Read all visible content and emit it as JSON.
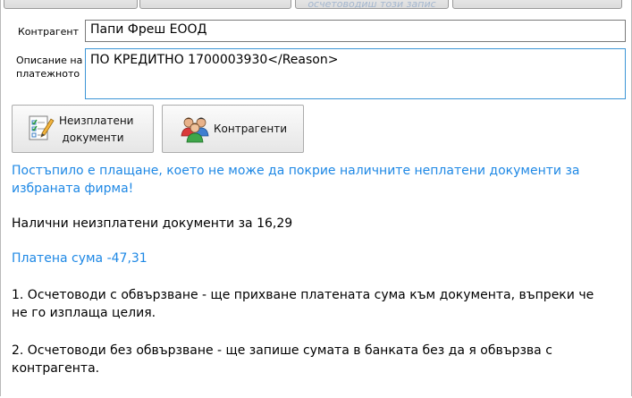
{
  "tabs": [
    {
      "label": ""
    },
    {
      "label": ""
    },
    {
      "label": "осчетоводиш този запис"
    },
    {
      "label": ""
    }
  ],
  "form": {
    "counterparty_label": "Контрагент",
    "counterparty_value": "Папи Фреш ЕООД",
    "description_label": "Описание на платежното",
    "description_value": "ПО КРЕДИТНО 1700003930</Reason>"
  },
  "buttons": {
    "unpaid_docs_label_line1": "Неизплатени",
    "unpaid_docs_label_line2": "документи",
    "counterparties_label": "Контрагенти"
  },
  "messages": {
    "warning": "Постъпило е плащане, което не може да покрие наличните неплатени документи за избраната фирма!",
    "available_unpaid": "Налични неизплатени документи за 16,29",
    "paid_amount": "Платена сума -47,31",
    "option1": "1. Осчетоводи с обвързване - ще прихване платената сума към документа, въпреки че не го изплаща целия.",
    "option2": "2. Осчетоводи без обвързване - ще запише сумата в банката без да я обвързва с контрагента."
  },
  "colors": {
    "info_blue": "#1e88e5",
    "focus_border": "#3c95d6"
  }
}
